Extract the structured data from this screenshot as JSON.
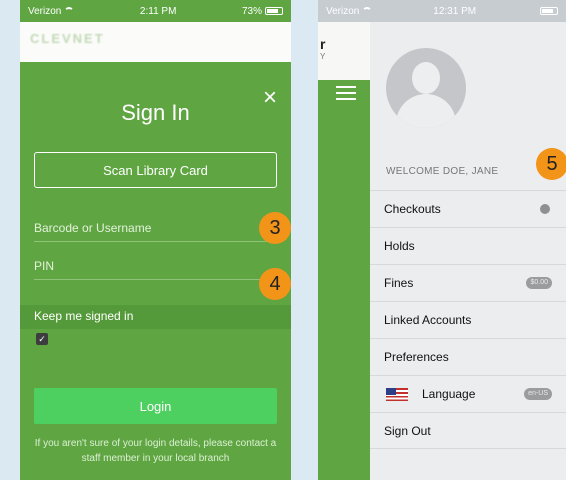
{
  "left_phone": {
    "status": {
      "carrier": "Verizon",
      "time": "2:11 PM",
      "battery": "73%"
    },
    "header_logo": "CLEVNET",
    "close_glyph": "×",
    "title": "Sign In",
    "scan_button": "Scan Library Card",
    "barcode_placeholder": "Barcode or Username",
    "pin_placeholder": "PIN",
    "keep_signed_in": "Keep me signed in",
    "keep_checked": true,
    "login_button": "Login",
    "help_text": "If you aren't sure of your login details, please contact a staff member in your local branch",
    "badge_barcode": "3",
    "badge_pin": "4",
    "accent": "#5fa643",
    "login_color": "#4ed061",
    "badge_color": "#f29418"
  },
  "right_phone": {
    "status": {
      "carrier": "Verizon",
      "time": "12:31 PM",
      "battery": ""
    },
    "logo_char": "r",
    "logo_sub": "Y",
    "welcome": "WELCOME DOE, JANE",
    "badge_menu": "5",
    "menu": [
      {
        "label": "Checkouts",
        "indicator": "dot"
      },
      {
        "label": "Holds"
      },
      {
        "label": "Fines",
        "pill": "$0.00"
      },
      {
        "label": "Linked Accounts"
      },
      {
        "label": "Preferences"
      },
      {
        "label": "Language",
        "pill": "en-US",
        "icon": "us-flag-icon"
      },
      {
        "label": "Sign Out"
      }
    ]
  }
}
